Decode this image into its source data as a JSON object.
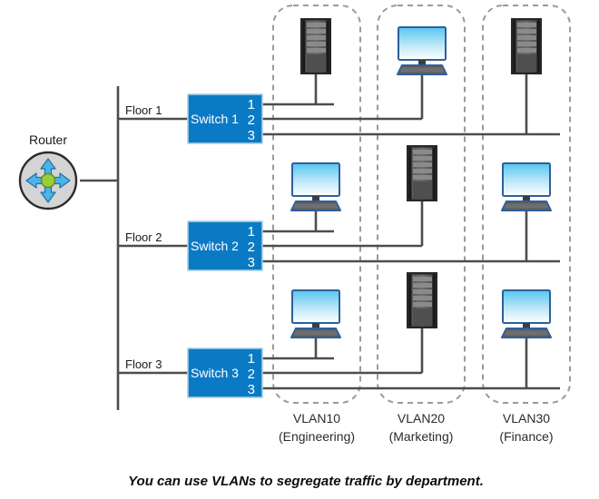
{
  "diagram": {
    "title": "VLAN segmentation network diagram",
    "caption": "You can use VLANs to segregate traffic by department.",
    "router": {
      "label": "Router",
      "icon": "router-icon",
      "body_color": "#d4d4d4",
      "border_color": "#2b2b2b",
      "arrow_color": "#4bb4e6",
      "arrow_border": "#1f6fa8",
      "hub_color": "#9ccc3c",
      "hub_border": "#5d8f1a"
    },
    "trunk": {
      "name": "backbone-trunk-line",
      "color": "#4d4d4d"
    },
    "floors": [
      {
        "floor_label": "Floor 1",
        "switch_label": "Switch 1",
        "ports": [
          "1",
          "2",
          "3"
        ]
      },
      {
        "floor_label": "Floor 2",
        "switch_label": "Switch 2",
        "ports": [
          "1",
          "2",
          "3"
        ]
      },
      {
        "floor_label": "Floor 3",
        "switch_label": "Switch 3",
        "ports": [
          "1",
          "2",
          "3"
        ]
      }
    ],
    "switch_style": {
      "fill": "#0b7ac4",
      "stroke": "#a8cfe8"
    },
    "vlans": [
      {
        "id": "VLAN10",
        "name": "(Engineering)",
        "devices": [
          "server",
          "workstation",
          "workstation"
        ]
      },
      {
        "id": "VLAN20",
        "name": "(Marketing)",
        "devices": [
          "workstation",
          "server",
          "server"
        ]
      },
      {
        "id": "VLAN30",
        "name": "(Finance)",
        "devices": [
          "server",
          "workstation",
          "workstation"
        ]
      }
    ],
    "vlan_box": {
      "stroke": "#9a9a9a",
      "dash": "6 5"
    },
    "device_style": {
      "screen_top": "#5ec8ef",
      "screen_bottom": "#ffffff",
      "screen_border": "#2d5f9a",
      "keyboard_fill": "#595959",
      "keyboard_border": "#2d5f9a",
      "server_body": "#4a4a4a",
      "server_edge": "#1c1c1c",
      "server_slot": "#7d7d7d",
      "stand_color": "#4d4d4d"
    }
  }
}
